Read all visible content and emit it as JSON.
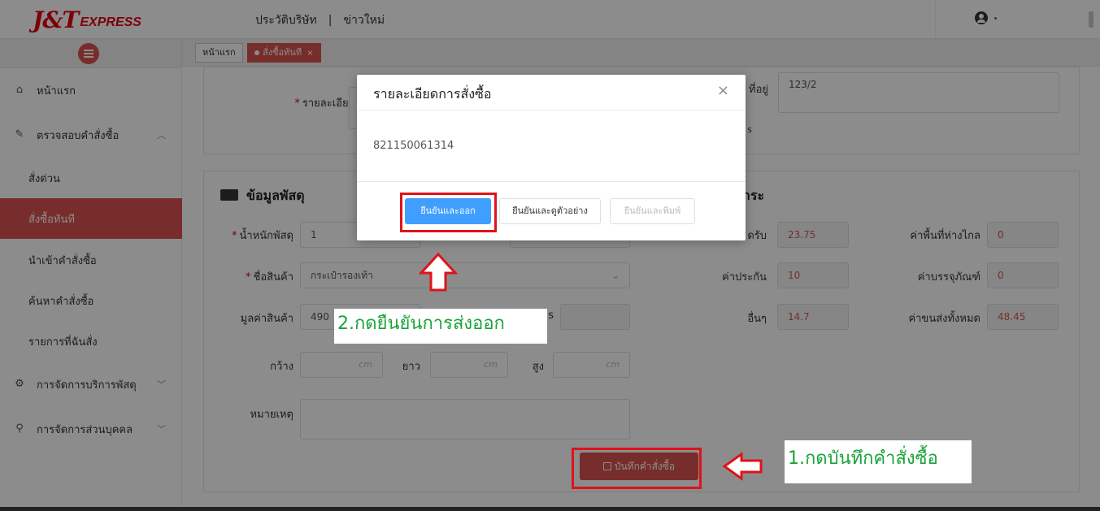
{
  "header": {
    "logo_jt": "J&T",
    "logo_express": "EXPRESS",
    "nav": [
      "ประวัติบริษัท",
      "ข่าวใหม่"
    ],
    "nav_separator": "|"
  },
  "sidebar": {
    "items": [
      {
        "label": "หน้าแรก",
        "icon": "home-icon"
      },
      {
        "label": "ตรวจสอบคำสั่งซื้อ",
        "icon": "edit-icon"
      },
      {
        "label": "สั่งด่วน"
      },
      {
        "label": "สั่งซื้อทันที"
      },
      {
        "label": "นำเข้าคำสั่งซื้อ"
      },
      {
        "label": "ค้นหาคำสั่งซื้อ"
      },
      {
        "label": "รายการที่ฉันสั่ง"
      },
      {
        "label": "การจัดการบริการพัสดุ",
        "icon": "parcel-icon"
      },
      {
        "label": "การจัดการส่วนบุคคล",
        "icon": "user-icon"
      }
    ]
  },
  "tabs": {
    "home": "หน้าแรก",
    "active": "สั่งซื้อทันที",
    "close": "×"
  },
  "address": {
    "label": "รายละเอียดที่อยู่",
    "label_right_partial": "ที่อยู่",
    "value_right": "123/2",
    "note_partial": "s"
  },
  "parcel": {
    "title": "ข้อมูลพัสดุ",
    "weight_label": "น้ำหนักพัสดุ",
    "weight_value": "1",
    "product_label": "ชื่อสินค้า",
    "product_value": "กระเป๋ารองเท้า",
    "value_label": "มูลค่าสินค้า",
    "value_value": "490",
    "value_partial_label": "s",
    "width_label": "กว้าง",
    "length_label": "ยาว",
    "height_label": "สูง",
    "unit_placeholder": "cm",
    "remark_label": "หมายเหตุ",
    "save_button": "บันทึกคำสั่งซื้อ"
  },
  "payment": {
    "title_partial": "ชำระ",
    "receive_label_partial": "ดรับ",
    "receive_value": "23.75",
    "remote_label": "ค่าพื้นที่ห่างไกล",
    "remote_value": "0",
    "insurance_label": "ค่าประกัน",
    "insurance_value": "10",
    "packing_label": "ค่าบรรจุภัณฑ์",
    "packing_value": "0",
    "other_label": "อื่นๆ",
    "other_value": "14.7",
    "total_label": "ค่าขนส่งทั้งหมด",
    "total_value": "48.45"
  },
  "modal": {
    "title": "รายละเอียดการสั่งซื้อ",
    "close": "×",
    "tracking_number": "821150061314",
    "btn_confirm_exit": "ยืนยันและออก",
    "btn_confirm_preview": "ยืนยันและดูตัวอย่าง",
    "btn_confirm_print": "ยืนยันและพิมพ์"
  },
  "annotations": {
    "step1": "1.กดบันทึกคำสั่งซื้อ",
    "step2": "2.กดยืนยันการส่งออก",
    "color_box": "#e0121a",
    "color_text": "#1aa33a"
  },
  "colors": {
    "brand": "#e60012",
    "active": "#d9534f",
    "primary": "#409eff"
  }
}
